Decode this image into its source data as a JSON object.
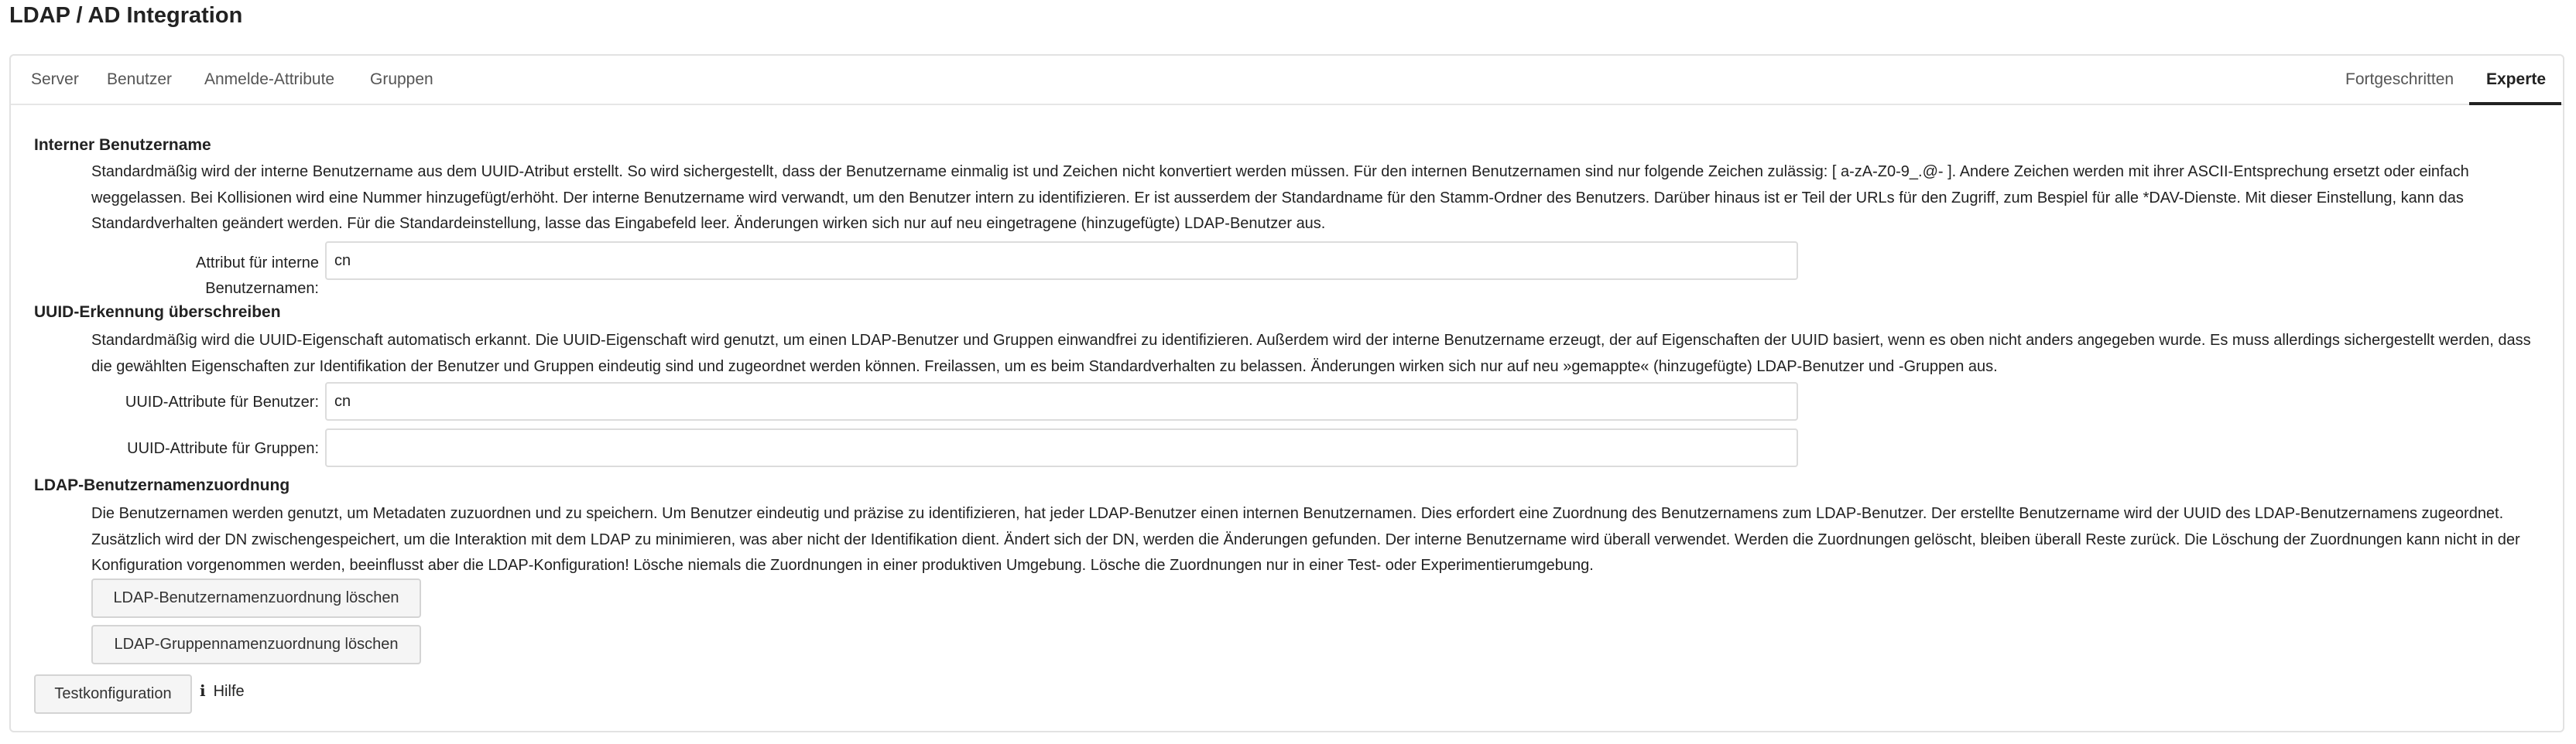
{
  "page": {
    "title": "LDAP / AD Integration"
  },
  "tabs": {
    "server": "Server",
    "users": "Benutzer",
    "login_attributes": "Anmelde-Attribute",
    "groups": "Gruppen",
    "advanced": "Fortgeschritten",
    "expert": "Experte",
    "active": "expert"
  },
  "internal_username": {
    "heading": "Interner Benutzername",
    "description": "Standardmäßig wird der interne Benutzername aus dem UUID-Atribut erstellt. So wird sichergestellt, dass der Benutzername einmalig ist und Zeichen nicht konvertiert werden müssen. Für den internen Benutzernamen sind nur folgende Zeichen zulässig: [ a-zA-Z0-9_.@- ]. Andere Zeichen werden mit ihrer ASCII-Entsprechung ersetzt oder einfach weggelassen. Bei Kollisionen wird eine Nummer hinzugefügt/erhöht. Der interne Benutzername wird verwandt, um den Benutzer intern zu identifizieren. Er ist ausserdem der Standardname für den Stamm-Ordner des Benutzers. Darüber hinaus ist er Teil der URLs für den Zugriff, zum Bespiel für alle *DAV-Dienste. Mit dieser Einstellung, kann das Standardverhalten geändert werden. Für die Standardeinstellung, lasse das Eingabefeld leer. Änderungen wirken sich nur auf neu eingetragene (hinzugefügte) LDAP-Benutzer aus.",
    "attribute_label": "Attribut für interne Benutzernamen:",
    "attribute_value": "cn"
  },
  "uuid_override": {
    "heading": "UUID-Erkennung überschreiben",
    "description": "Standardmäßig wird die UUID-Eigenschaft automatisch erkannt. Die UUID-Eigenschaft wird genutzt, um einen LDAP-Benutzer und Gruppen einwandfrei zu identifizieren. Außerdem wird der interne Benutzername erzeugt, der auf Eigenschaften der UUID basiert, wenn es oben nicht anders angegeben wurde. Es muss allerdings sichergestellt werden, dass die gewählten Eigenschaften zur Identifikation der Benutzer und Gruppen eindeutig sind und zugeordnet werden können. Freilassen, um es beim Standardverhalten zu belassen. Änderungen wirken sich nur auf neu »gemappte« (hinzugefügte) LDAP-Benutzer und -Gruppen aus.",
    "users_label": "UUID-Attribute für Benutzer:",
    "users_value": "cn",
    "groups_label": "UUID-Attribute für Gruppen:",
    "groups_value": ""
  },
  "username_mapping": {
    "heading": "LDAP-Benutzernamenzuordnung",
    "description": "Die Benutzernamen werden genutzt, um Metadaten zuzuordnen und zu speichern. Um Benutzer eindeutig und präzise zu identifizieren, hat jeder LDAP-Benutzer einen internen Benutzernamen. Dies erfordert eine Zuordnung des Benutzernamens zum LDAP-Benutzer. Der erstellte Benutzername wird der UUID des LDAP-Benutzernamens zugeordnet. Zusätzlich wird der DN zwischengespeichert, um die Interaktion mit dem LDAP zu minimieren, was aber nicht der Identifikation dient. Ändert sich der DN, werden die Änderungen gefunden. Der interne Benutzername wird überall verwendet. Werden die Zuordnungen gelöscht, bleiben überall Reste zurück. Die Löschung der Zuordnungen kann nicht in der Konfiguration vorgenommen werden, beeinflusst aber die LDAP-Konfiguration! Lösche niemals die Zuordnungen in einer produktiven Umgebung. Lösche die Zuordnungen nur in einer Test- oder Experimentierumgebung.",
    "clear_user_mapping": "LDAP-Benutzernamenzuordnung löschen",
    "clear_group_mapping": "LDAP-Gruppennamenzuordnung löschen"
  },
  "footer": {
    "test_button": "Testkonfiguration",
    "help_icon": "info-icon",
    "help_label": "Hilfe"
  }
}
